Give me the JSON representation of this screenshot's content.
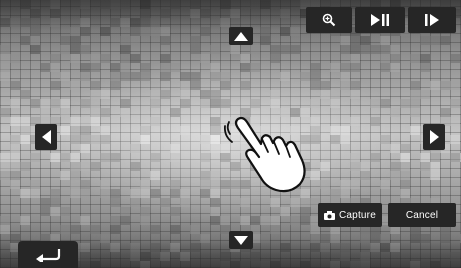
{
  "topbar": {
    "zoom_icon": "magnifier-icon",
    "play_pause_icon": "play-pause-icon",
    "next_icon": "next-frame-icon"
  },
  "nav": {
    "up_icon": "arrow-up-icon",
    "down_icon": "arrow-down-icon",
    "left_icon": "arrow-left-icon",
    "right_icon": "arrow-right-icon"
  },
  "actions": {
    "capture_label": "Capture",
    "cancel_label": "Cancel"
  },
  "footer": {
    "back_icon": "return-icon"
  },
  "overlay": {
    "gesture_icon": "tap-hand-icon"
  },
  "colors": {
    "button_bg": "#262626",
    "button_fg": "#ffffff"
  }
}
